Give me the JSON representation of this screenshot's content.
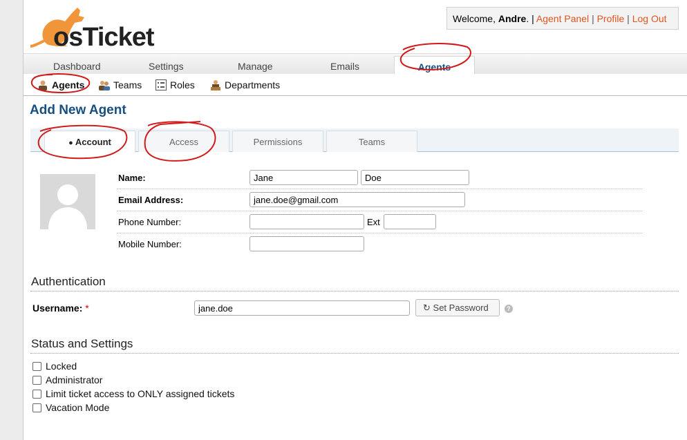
{
  "header": {
    "logo_text": "osTicket",
    "welcome_prefix": "Welcome, ",
    "user_name": "Andre",
    "welcome_suffix": ". |",
    "links": [
      "Agent Panel",
      "Profile",
      "Log Out"
    ],
    "separator": "|"
  },
  "nav": {
    "tabs": [
      "Dashboard",
      "Settings",
      "Manage",
      "Emails",
      "Agents"
    ],
    "active": "Agents"
  },
  "subnav": {
    "items": [
      "Agents",
      "Teams",
      "Roles",
      "Departments"
    ],
    "active": "Agents"
  },
  "page": {
    "title": "Add New Agent"
  },
  "form_tabs": {
    "items": [
      "Account",
      "Access",
      "Permissions",
      "Teams"
    ],
    "active": "Account"
  },
  "account": {
    "name_label": "Name:",
    "first_name": "Jane",
    "last_name": "Doe",
    "email_label": "Email Address:",
    "email": "jane.doe@gmail.com",
    "phone_label": "Phone Number:",
    "phone": "",
    "ext_label": "Ext",
    "ext": "",
    "mobile_label": "Mobile Number:",
    "mobile": ""
  },
  "authentication": {
    "title": "Authentication",
    "username_label": "Username:",
    "required_mark": "*",
    "username": "jane.doe",
    "set_password_label": "Set Password",
    "help_glyph": "?"
  },
  "status": {
    "title": "Status and Settings",
    "options": [
      {
        "label": "Locked",
        "checked": false
      },
      {
        "label": "Administrator",
        "checked": false
      },
      {
        "label": "Limit ticket access to ONLY assigned tickets",
        "checked": false
      },
      {
        "label": "Vacation Mode",
        "checked": false
      }
    ]
  },
  "colors": {
    "brand_orange": "#e0541e",
    "title_blue": "#184e81",
    "annotation_red": "#d11a1a"
  },
  "icons": {
    "user_icon": "person-icon",
    "refresh_icon": "refresh-icon",
    "help_icon": "help-icon"
  }
}
